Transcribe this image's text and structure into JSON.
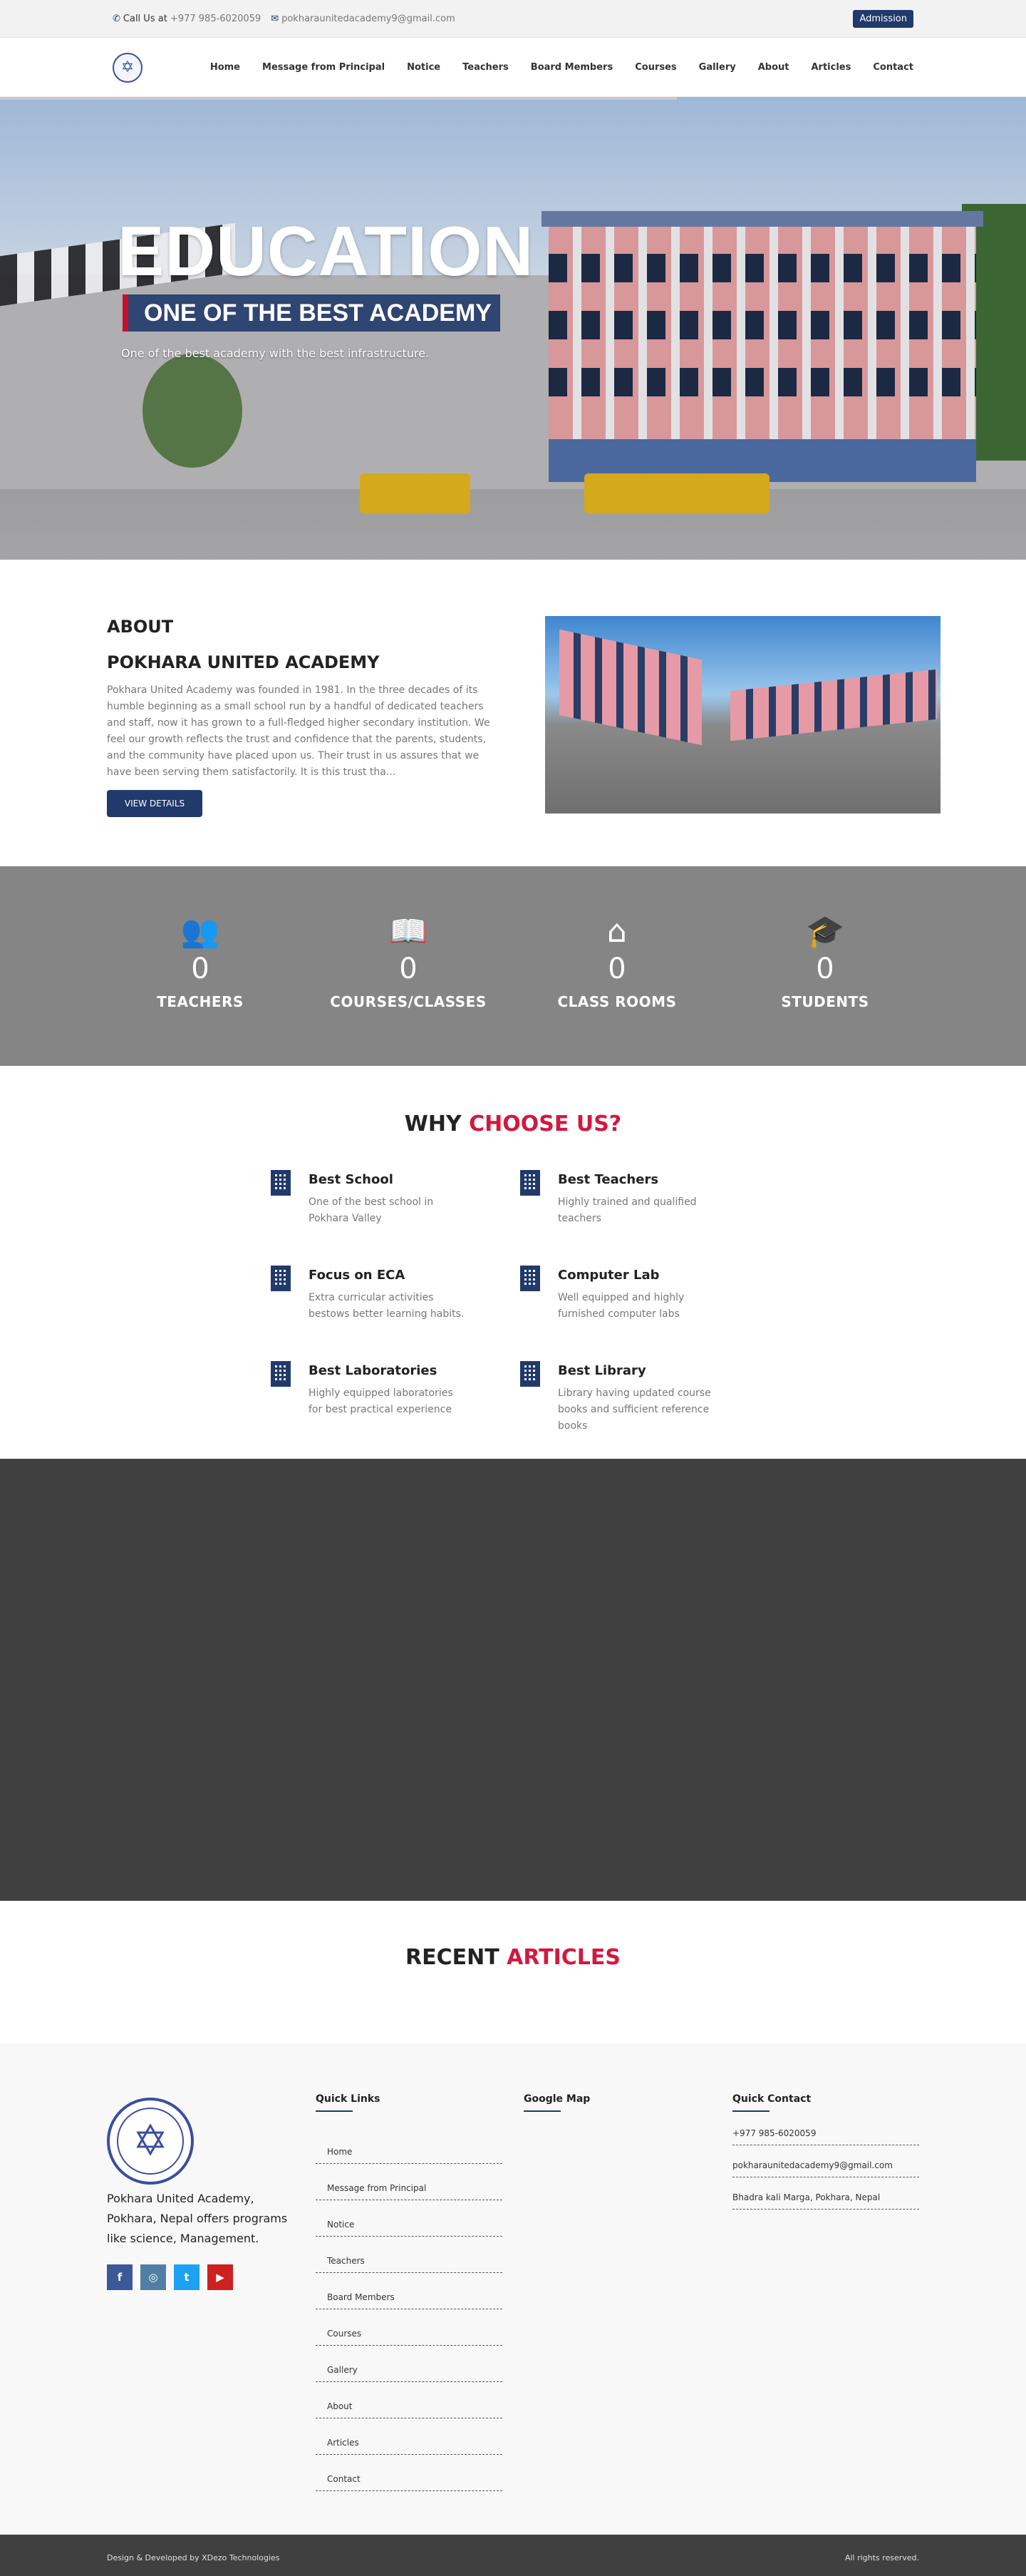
{
  "topbar": {
    "call_label": "Call Us at",
    "phone": "+977 985-6020059",
    "email": "pokharaunitedacademy9@gmail.com",
    "admission_label": "Admission"
  },
  "nav": {
    "items": [
      "Home",
      "Message from Principal",
      "Notice",
      "Teachers",
      "Board Members",
      "Courses",
      "Gallery",
      "About",
      "Articles",
      "Contact"
    ]
  },
  "hero": {
    "title": "EDUCATION",
    "ribbon": "ONE OF THE BEST ACADEMY",
    "tagline": "One of the best academy with the best infrastructure."
  },
  "about": {
    "heading": "ABOUT",
    "subheading": "POKHARA UNITED ACADEMY",
    "body": "Pokhara United Academy was founded in 1981. In the three decades of its humble beginning as a small school run by a handful of dedicated teachers and staff, now it has grown to a full-fledged higher secondary institution. We feel our growth reflects the trust and confidence that the parents, students, and the community have placed upon us. Their trust in us assures that we have been serving them satisfactorily. It is this trust tha...",
    "button_label": "VIEW DETAILS"
  },
  "stats": [
    {
      "icon": "users-icon",
      "value": "0",
      "label": "TEACHERS"
    },
    {
      "icon": "book-icon",
      "value": "0",
      "label": "COURSES/CLASSES"
    },
    {
      "icon": "home-icon",
      "value": "0",
      "label": "CLASS ROOMS"
    },
    {
      "icon": "graduation-cap-icon",
      "value": "0",
      "label": "STUDENTS"
    }
  ],
  "why": {
    "title_plain": "WHY",
    "title_accent": "CHOOSE US?",
    "features": [
      {
        "title": "Best School",
        "desc": "One of the best school in Pokhara Valley"
      },
      {
        "title": "Best Teachers",
        "desc": "Highly trained and qualified teachers"
      },
      {
        "title": "Focus on ECA",
        "desc": "Extra curricular activities bestows better learning habits."
      },
      {
        "title": "Computer Lab",
        "desc": "Well equipped and highly furnished computer labs"
      },
      {
        "title": "Best Laboratories",
        "desc": "Highly equipped laboratories for best practical experience"
      },
      {
        "title": "Best Library",
        "desc": "Library having updated course books and sufficient reference books"
      }
    ]
  },
  "articles": {
    "title_plain": "RECENT",
    "title_accent": "ARTICLES"
  },
  "footer": {
    "about_text": "Pokhara United Academy, Pokhara, Nepal offers programs like science, Management.",
    "quick_links_title": "Quick Links",
    "quick_links": [
      "Home",
      "Message from Principal",
      "Notice",
      "Teachers",
      "Board Members",
      "Courses",
      "Gallery",
      "About",
      "Articles",
      "Contact"
    ],
    "map_title": "Google Map",
    "contact_title": "Quick Contact",
    "contact": [
      "+977 985-6020059",
      "pokharaunitedacademy9@gmail.com",
      "Bhadra kali Marga, Pokhara, Nepal"
    ],
    "social": [
      {
        "icon": "facebook-icon",
        "color": "#3b5998",
        "glyph": "f"
      },
      {
        "icon": "instagram-icon",
        "color": "#517fa4",
        "glyph": "◎"
      },
      {
        "icon": "twitter-icon",
        "color": "#1da1f2",
        "glyph": "t"
      },
      {
        "icon": "youtube-icon",
        "color": "#cd201f",
        "glyph": "▶"
      }
    ],
    "credit": "Design & Developed by XDezo Technologies",
    "rights": "All rights reserved."
  },
  "colors": {
    "brand": "#213a6b",
    "accent": "#d2193f",
    "stats_bg": "#858585",
    "dark_bg": "#404040"
  }
}
